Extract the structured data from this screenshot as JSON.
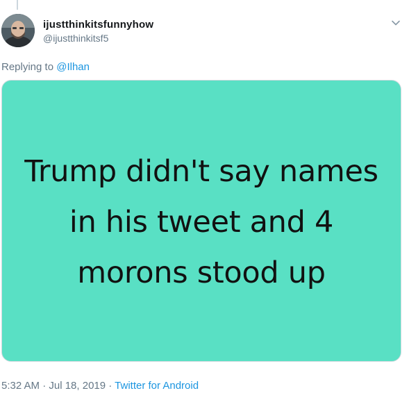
{
  "tweet": {
    "display_name": "ijustthinkitsfunnyhow",
    "handle": "@ijustthinkitsf5",
    "replying_prefix": "Replying to",
    "replying_to": "@Ilhan",
    "media_text": "Trump didn't say names in his tweet and 4 morons stood up",
    "timestamp": "5:32 AM · Jul 18, 2019 ·",
    "source": "Twitter for Android"
  },
  "icons": {
    "avatar": "avatar-photo",
    "caret": "chevron-down-icon"
  },
  "colors": {
    "media_background": "#59e0c4",
    "link": "#1b95e0",
    "secondary_text": "#657786",
    "primary_text": "#14171a"
  }
}
